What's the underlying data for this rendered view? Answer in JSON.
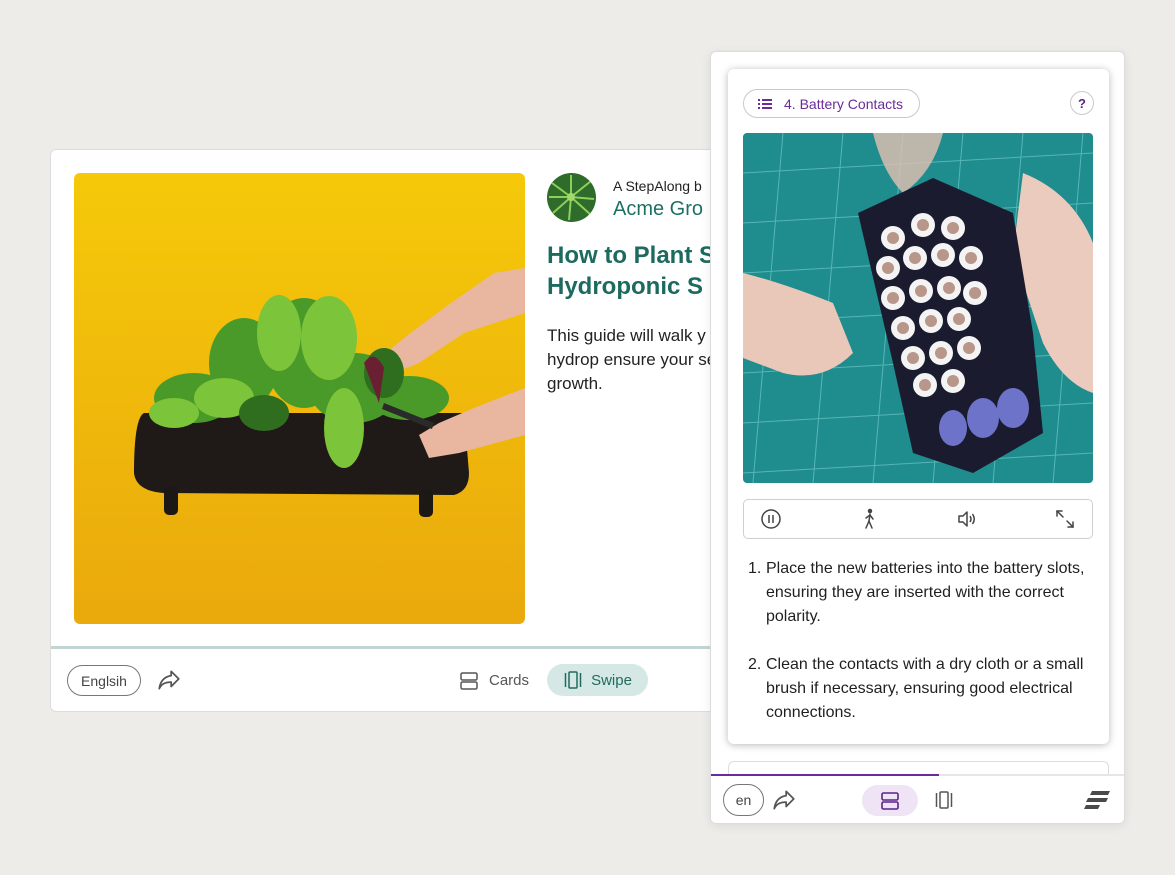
{
  "guide": {
    "author_prefix": "A StepAlong b",
    "author_name": "Acme Gro",
    "title_line1": "How to Plant S",
    "title_line2": "Hydroponic S",
    "description": "This guide will walk y seeds using a hydrop ensure your seeds a successful growth.",
    "hero_image": "plant-pot-photo",
    "avatar_image": "fern-avatar"
  },
  "back_footer": {
    "language": "Englsih",
    "cards_label": "Cards",
    "swipe_label": "Swipe"
  },
  "phone": {
    "step_label": "4. Battery Contacts",
    "help_label": "?",
    "video_image": "battery-pack-photo",
    "controls": [
      "pause-icon",
      "walk-icon",
      "volume-icon",
      "fullscreen-icon"
    ],
    "steps": [
      {
        "num": "1.",
        "text": "Place the new batteries into the battery slots, ensuring they are inserted with the correct polarity."
      },
      {
        "num": "2.",
        "text": "Clean the contacts with a dry cloth or a small brush if necessary, ensuring good electrical connections."
      }
    ],
    "progress_fraction": 0.55,
    "language": "en"
  },
  "colors": {
    "teal": "#1e7064",
    "purple": "#6a2b9b",
    "swipe_bg": "#d6e8e6",
    "cards_bg": "#efe3f6",
    "hero_bg": "#f1b809"
  }
}
